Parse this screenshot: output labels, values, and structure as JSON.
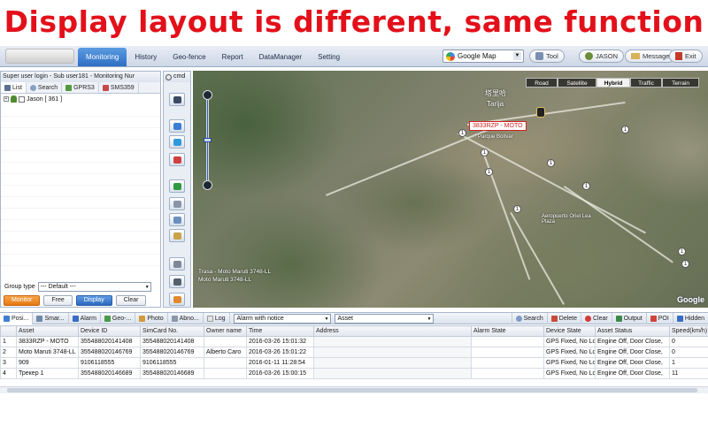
{
  "banner": {
    "text": "Display layout is different, same function"
  },
  "nav": {
    "tabs": [
      "Monitoring",
      "History",
      "Geo-fence",
      "Report",
      "DataManager",
      "Setting"
    ]
  },
  "toolbar": {
    "map_select": "Google Map",
    "tool": "Tool",
    "user": "JASON",
    "message": "Message",
    "exit": "Exit"
  },
  "left": {
    "title": "Super user login - Sub user181 - Monitoring Nur",
    "tabs": [
      "List",
      "Search",
      "GPRS3",
      "SMS359"
    ],
    "tree_item": "Jason [ 361 ]",
    "group_label": "Group type",
    "group_value": "--- Default ---",
    "buttons": [
      "Monitor",
      "Free",
      "Display",
      "Clear"
    ]
  },
  "mid": {
    "cmd": "cmd"
  },
  "map": {
    "types": [
      "Road",
      "Satellite",
      "Hybrid",
      "Traffic",
      "Terrain"
    ],
    "city": "Tarija",
    "city_native": "塔里哈",
    "vehicle_label": "3833RZP - MOTO",
    "place1": "Parque Bolívar",
    "place2": "Aeropuerto Oriel Lea Plaza",
    "pos1": "Trasa - Moto Maruti 3748-LL",
    "pos2": "Moto Maruti 3748-LL",
    "google": "Google"
  },
  "bottom": {
    "tabs": [
      "Posi...",
      "Smar...",
      "Alarm",
      "Geo-...",
      "Photo",
      "Abno...",
      "Log"
    ],
    "alarm_select": "Alarm with notice",
    "asset_select": "Asset",
    "actions": [
      "Search",
      "Delete",
      "Clear",
      "Output",
      "POI",
      "Hidden"
    ]
  },
  "table": {
    "columns": [
      "",
      "Asset",
      "Device ID",
      "SimCard No.",
      "Owner name",
      "Time",
      "Address",
      "Alarm State",
      "Device State",
      "Asset Status",
      "Speed(km/h)"
    ],
    "rows": [
      [
        "1",
        "3833RZP - MOTO",
        "355488020141408",
        "355488020141408",
        "",
        "2016-03-26 15:01:32",
        "",
        "",
        "GPS Fixed, No Lo",
        "Engine Off, Door Close,",
        "0"
      ],
      [
        "2",
        "Moto Maruti 3748-LL",
        "355488020146769",
        "355488020146769",
        "Alberto Caro",
        "2016-03-26 15:01:22",
        "",
        "",
        "GPS Fixed, No Lo",
        "Engine Off, Door Close,",
        "0"
      ],
      [
        "3",
        "909",
        "9106118555",
        "9106118555",
        "",
        "2016-01-11 11:28:54",
        "",
        "",
        "GPS Fixed, No Lo",
        "Engine Off, Door Close,",
        "1"
      ],
      [
        "4",
        "Трекер 1",
        "355488020146689",
        "355488020146689",
        "",
        "2016-03-26 15:00:15",
        "",
        "",
        "GPS Fixed, No Lo",
        "Engine Off, Door Close,",
        "11"
      ]
    ]
  },
  "colors": {
    "banner": "#e3101a",
    "active_tab": "#2f6fc4",
    "monitor_btn": "#e57812",
    "display_btn": "#2c68bd"
  }
}
